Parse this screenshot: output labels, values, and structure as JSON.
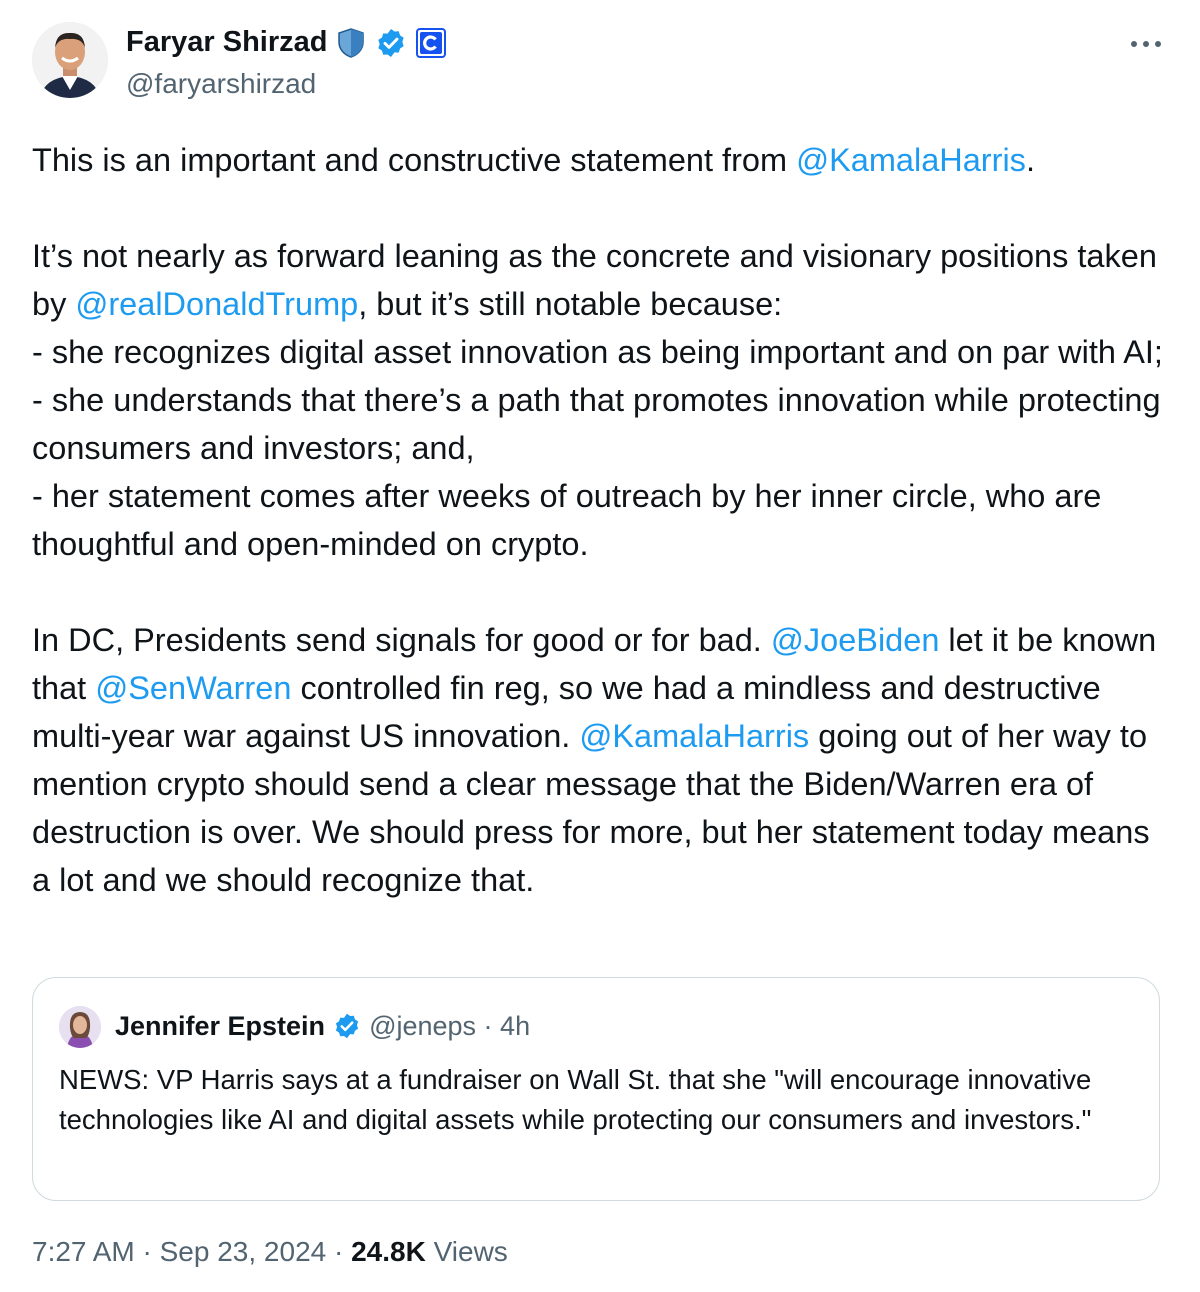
{
  "author": {
    "name": "Faryar Shirzad",
    "handle": "@faryarshirzad",
    "badges": [
      "shield-badge-icon",
      "verified-badge-icon",
      "affiliate-badge-icon"
    ]
  },
  "body": {
    "p1_text": "This is an important and constructive statement from ",
    "p1_mention": "@KamalaHarris",
    "p1_end": ".",
    "p2_line1": "It’s not nearly as forward leaning as the concrete and visionary positions taken by ",
    "p2_mention": "@realDonaldTrump",
    "p2_line1_end": ", but it’s still notable because:",
    "bullet1": "- she recognizes digital asset innovation as being important and on par with AI;",
    "bullet2": "- she understands that there’s a path that promotes innovation while protecting consumers and investors; and,",
    "bullet3": "- her statement comes after weeks of outreach by her inner circle, who are  thoughtful and open-minded on crypto.",
    "p3_a": "In DC, Presidents send signals for good or for bad. ",
    "p3_mention1": "@JoeBiden",
    "p3_b": " let it be known that ",
    "p3_mention2": "@SenWarren",
    "p3_c": " controlled fin reg, so we had a mindless and destructive multi-year war against US innovation.  ",
    "p3_mention3": "@KamalaHarris",
    "p3_d": " going out of her way to mention crypto should send a clear message that the Biden/Warren era of destruction is over.  We should press for more, but her statement today means a lot and we should recognize that."
  },
  "quoted": {
    "name": "Jennifer Epstein",
    "handle": "@jeneps",
    "separator": " · ",
    "time": "4h",
    "text": "NEWS: VP Harris says at a fundraiser on Wall St. that she \"will encourage innovative technologies like AI and digital assets while protecting our consumers and investors.\""
  },
  "footer": {
    "time": "7:27 AM",
    "sep1": " · ",
    "date": "Sep 23, 2024",
    "sep2": " · ",
    "views_count": "24.8K",
    "views_label": " Views"
  },
  "colors": {
    "link": "#1d9bf0",
    "secondary_text": "#536471",
    "primary_text": "#0f1419",
    "border": "#cfd9de"
  }
}
